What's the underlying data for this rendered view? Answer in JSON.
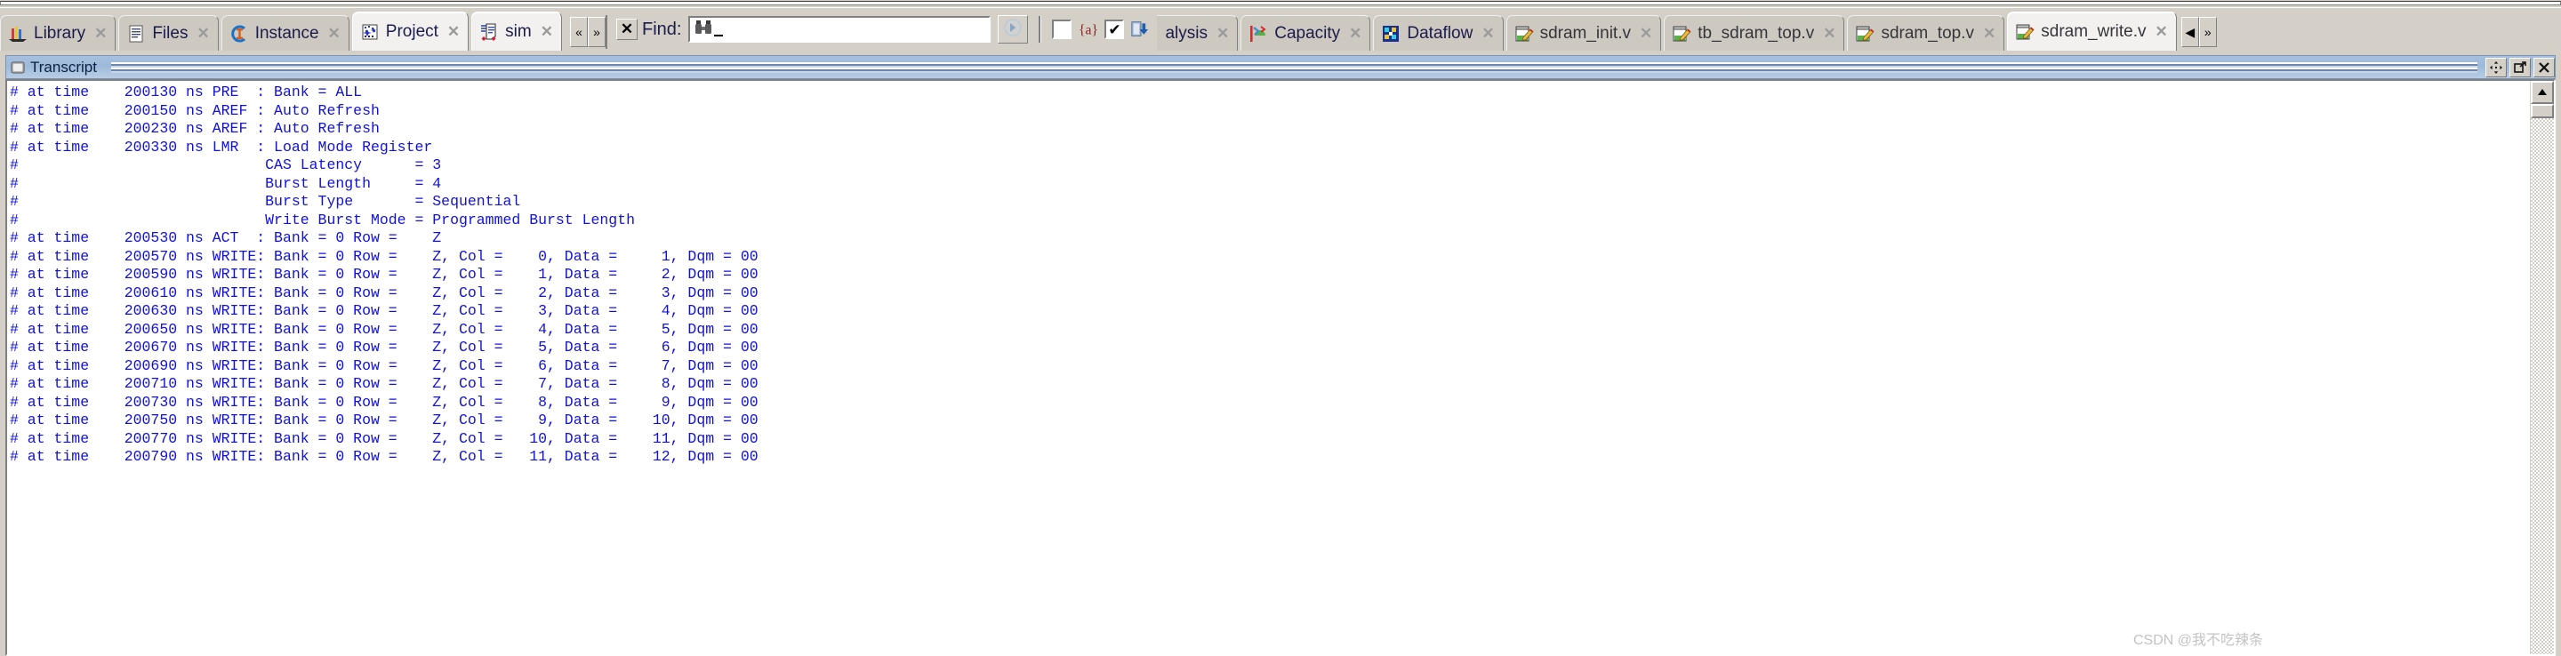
{
  "window": {
    "left_tabs": [
      {
        "label": "Library",
        "icon": "library-bars-icon",
        "active": false
      },
      {
        "label": "Files",
        "icon": "files-document-icon",
        "active": false
      },
      {
        "label": "Instance",
        "icon": "instance-c-icon",
        "active": false
      },
      {
        "label": "Project",
        "icon": "project-stars-icon",
        "active": true
      },
      {
        "label": "sim",
        "icon": "sim-wave-icon",
        "active": true
      }
    ],
    "tab_scroll": {
      "prev": "«",
      "next": "»"
    },
    "right_tabs": [
      {
        "label": "alysis",
        "icon": "analysis-icon",
        "active": false,
        "clipped": true
      },
      {
        "label": "Capacity",
        "icon": "capacity-icon",
        "active": false
      },
      {
        "label": "Dataflow",
        "icon": "dataflow-icon",
        "active": false
      },
      {
        "label": "sdram_init.v",
        "icon": "verilog-file-icon",
        "active": false
      },
      {
        "label": "tb_sdram_top.v",
        "icon": "verilog-file-icon",
        "active": false
      },
      {
        "label": "sdram_top.v",
        "icon": "verilog-file-icon",
        "active": false
      },
      {
        "label": "sdram_write.v",
        "icon": "verilog-file-icon",
        "active": true
      }
    ],
    "right_tab_scroll": {
      "prev": "◀",
      "next": "»"
    },
    "tab_close_glyph": "✕"
  },
  "find_bar": {
    "close_label": "✕",
    "label": "Find:",
    "input_value": "",
    "input_placeholder": "",
    "search_icon": "binoculars-icon",
    "go_icon": "find-next-icon",
    "options": [
      {
        "name": "match-regex",
        "checked": false,
        "glyph": "{a}",
        "icon": "regex-brace-a-icon"
      },
      {
        "name": "search-all",
        "checked": true,
        "glyph": "✔",
        "icon": "search-in-field-icon"
      }
    ],
    "checked_glyph": "✔"
  },
  "transcript": {
    "title": "Transcript",
    "title_icon": "transcript-window-icon",
    "buttons": [
      {
        "name": "undock-button",
        "icon": "move-arrows-icon",
        "glyph": "✥"
      },
      {
        "name": "maximize-button",
        "icon": "maximize-icon",
        "glyph": "↗"
      },
      {
        "name": "close-button",
        "icon": "close-icon",
        "glyph": "✕"
      }
    ],
    "lines": [
      "# at time    200130 ns PRE  : Bank = ALL",
      "# at time    200150 ns AREF : Auto Refresh",
      "# at time    200230 ns AREF : Auto Refresh",
      "# at time    200330 ns LMR  : Load Mode Register",
      "#                            CAS Latency      = 3",
      "#                            Burst Length     = 4",
      "#                            Burst Type       = Sequential",
      "#                            Write Burst Mode = Programmed Burst Length",
      "# at time    200530 ns ACT  : Bank = 0 Row =    Z",
      "# at time    200570 ns WRITE: Bank = 0 Row =    Z, Col =    0, Data =     1, Dqm = 00",
      "# at time    200590 ns WRITE: Bank = 0 Row =    Z, Col =    1, Data =     2, Dqm = 00",
      "# at time    200610 ns WRITE: Bank = 0 Row =    Z, Col =    2, Data =     3, Dqm = 00",
      "# at time    200630 ns WRITE: Bank = 0 Row =    Z, Col =    3, Data =     4, Dqm = 00",
      "# at time    200650 ns WRITE: Bank = 0 Row =    Z, Col =    4, Data =     5, Dqm = 00",
      "# at time    200670 ns WRITE: Bank = 0 Row =    Z, Col =    5, Data =     6, Dqm = 00",
      "# at time    200690 ns WRITE: Bank = 0 Row =    Z, Col =    6, Data =     7, Dqm = 00",
      "# at time    200710 ns WRITE: Bank = 0 Row =    Z, Col =    7, Data =     8, Dqm = 00",
      "# at time    200730 ns WRITE: Bank = 0 Row =    Z, Col =    8, Data =     9, Dqm = 00",
      "# at time    200750 ns WRITE: Bank = 0 Row =    Z, Col =    9, Data =    10, Dqm = 00",
      "# at time    200770 ns WRITE: Bank = 0 Row =    Z, Col =   10, Data =    11, Dqm = 00",
      "# at time    200790 ns WRITE: Bank = 0 Row =    Z, Col =   11, Data =    12, Dqm = 00"
    ],
    "scrollbar": {
      "up_glyph": "▲",
      "down_glyph": "▼"
    }
  },
  "watermark": "CSDN @我不吃辣条",
  "colors": {
    "text_blue": "#1111dd",
    "tab_label": "#1b1b4b",
    "chrome": "#d4d0c8",
    "titlebar_blue": "#9dbada"
  }
}
